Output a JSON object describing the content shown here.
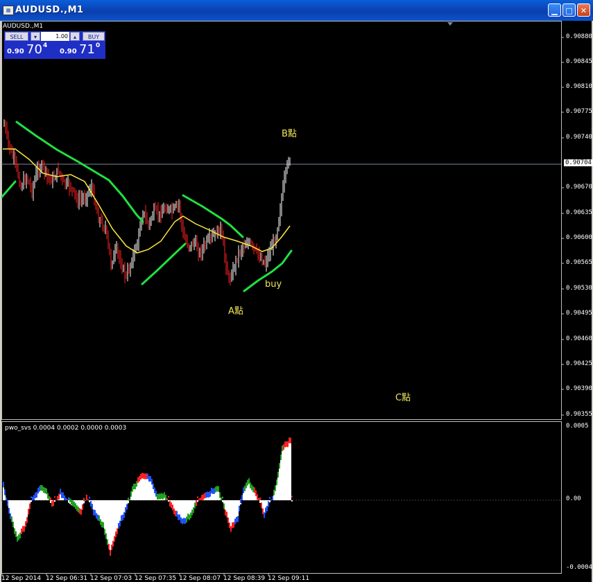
{
  "window": {
    "title": "AUDUSD.,M1",
    "app_icon": "chart-window-icon"
  },
  "chart_tab": "AUDUSD.,M1",
  "panel": {
    "sell_label": "SELL",
    "buy_label": "BUY",
    "lot": "1.00",
    "sell_big": "0.90",
    "sell_price_main": "70",
    "sell_price_sup": "4",
    "buy_big": "0.90",
    "buy_price_main": "71",
    "buy_price_sup": "0"
  },
  "price_axis": {
    "labels": [
      "0.90880",
      "0.90845",
      "0.90810",
      "0.90775",
      "0.90740",
      "0.90670",
      "0.90635",
      "0.90600",
      "0.90565",
      "0.90530",
      "0.90495",
      "0.90460",
      "0.90425",
      "0.90390",
      "0.90355"
    ],
    "current_price": "0.90704"
  },
  "time_axis": [
    "12 Sep 2014",
    "12 Sep 06:31",
    "12 Sep 07:03",
    "12 Sep 07:35",
    "12 Sep 08:07",
    "12 Sep 08:39",
    "12 Sep 09:11"
  ],
  "annotations": {
    "b_point": "B點",
    "a_point": "A點",
    "c_point": "C點",
    "buy": "buy"
  },
  "indicator": {
    "title": "pwo_svs 0.0004 0.0002 0.0000 0.0003",
    "axis_labels": [
      "0.0005",
      "0.00",
      "-0.0004"
    ]
  },
  "colors": {
    "bull": "#ffffff",
    "bear": "#ff2020",
    "ma_fast": "#ffe840",
    "envelope": "#20e040",
    "bg": "#000000"
  }
}
